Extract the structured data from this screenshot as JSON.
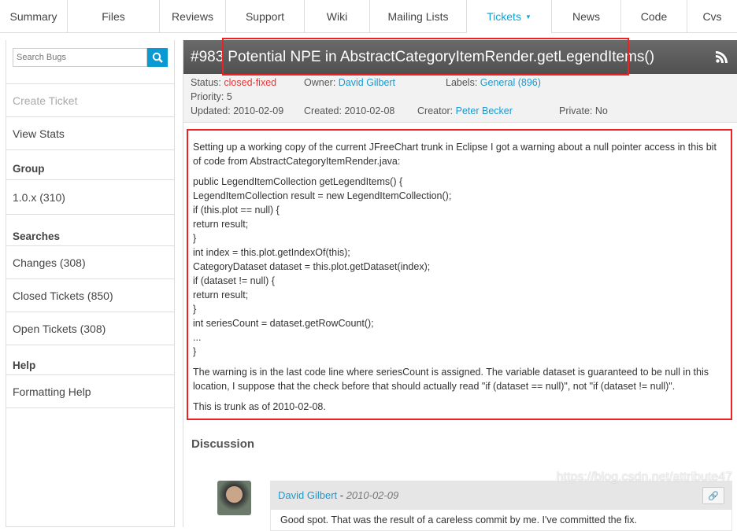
{
  "tabs": [
    "Summary",
    "Files",
    "Reviews",
    "Support",
    "Wiki",
    "Mailing Lists",
    "Tickets",
    "News",
    "Code",
    "Cvs"
  ],
  "sidebar": {
    "search_placeholder": "Search Bugs",
    "create": "Create Ticket",
    "stats": "View Stats",
    "group_head": "Group",
    "group_items": [
      "1.0.x (310)"
    ],
    "searches_head": "Searches",
    "searches": [
      "Changes (308)",
      "Closed Tickets (850)",
      "Open Tickets (308)"
    ],
    "help_head": "Help",
    "help_items": [
      "Formatting Help"
    ]
  },
  "ticket": {
    "number": "#983",
    "title": "Potential NPE in AbstractCategoryItemRender.getLegendItems()",
    "status_label": "Status:",
    "status": "closed-fixed",
    "owner_label": "Owner:",
    "owner": "David Gilbert",
    "labels_label": "Labels:",
    "labels": "General (896)",
    "priority_label": "Priority:",
    "priority": "5",
    "updated_label": "Updated:",
    "updated": "2010-02-09",
    "created_label": "Created:",
    "created": "2010-02-08",
    "creator_label": "Creator:",
    "creator": "Peter Becker",
    "private_label": "Private:",
    "private": "No"
  },
  "description": {
    "intro": "Setting up a working copy of the current JFreeChart trunk in Eclipse I got a warning about a null pointer access in this bit of code from AbstractCategoryItemRender.java:",
    "code": [
      "public LegendItemCollection getLegendItems() {",
      "LegendItemCollection result = new LegendItemCollection();",
      "if (this.plot == null) {",
      "return result;",
      "}",
      "int index = this.plot.getIndexOf(this);",
      "CategoryDataset dataset = this.plot.getDataset(index);",
      "if (dataset != null) {",
      "return result;",
      "}",
      "int seriesCount = dataset.getRowCount();",
      "...",
      "}"
    ],
    "para2": "The warning is in the last code line where seriesCount is assigned. The variable dataset is guaranteed to be null in this location, I suppose that the check before that should actually read \"if (dataset == null)\", not \"if (dataset != null)\".",
    "para3": "This is trunk as of 2010-02-08."
  },
  "discussion": {
    "heading": "Discussion",
    "comment": {
      "author": "David Gilbert",
      "sep": " - ",
      "date": "2010-02-09",
      "body": "Good spot. That was the result of a careless commit by me. I've committed the fix."
    }
  },
  "watermark": "https://blog.csdn.net/attribute47",
  "colors": {
    "accent": "#0fa2d6",
    "status": "#e33333",
    "highlight": "#e22222"
  }
}
